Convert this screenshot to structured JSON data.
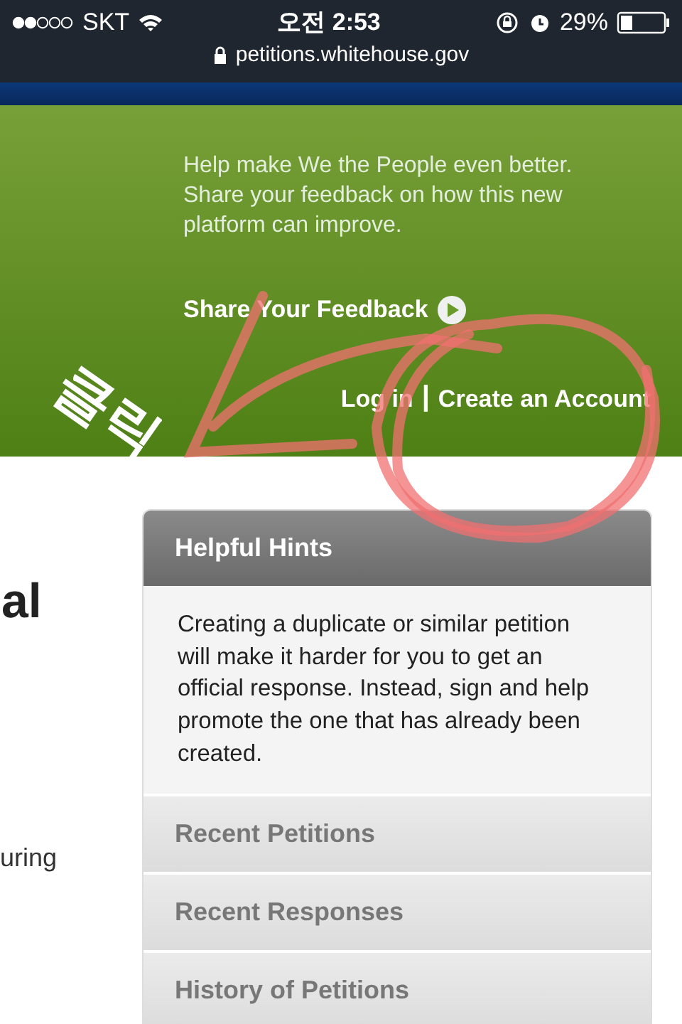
{
  "status_bar": {
    "carrier": "SKT",
    "time": "오전 2:53",
    "battery": "29%"
  },
  "address_bar": {
    "url": "petitions.whitehouse.gov"
  },
  "banner": {
    "message": "Help make We the People even better. Share your feedback on how this new platform can improve.",
    "feedback_link": "Share Your Feedback",
    "login_link": "Log in",
    "separator": "|",
    "create_account_link": "Create an Account"
  },
  "main": {
    "heading_fragment": "al",
    "text_fragment": "uring"
  },
  "sidebar": {
    "header": "Helpful Hints",
    "hint": "Creating a duplicate or similar petition will make it harder for you to get an official response. Instead, sign and help promote the one that has already been created.",
    "items": [
      {
        "label": "Recent Petitions"
      },
      {
        "label": "Recent Responses"
      },
      {
        "label": "History of Petitions"
      }
    ]
  },
  "annotation": {
    "text": "클릭"
  }
}
